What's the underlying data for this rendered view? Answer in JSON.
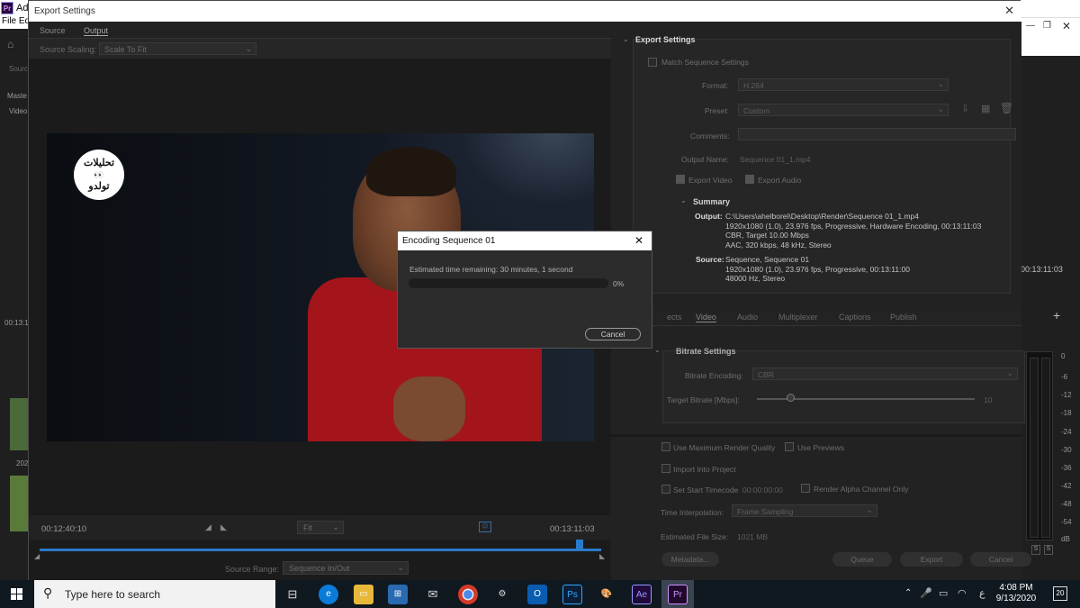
{
  "app": {
    "title": "Ado",
    "menu": [
      "File",
      "Ed"
    ],
    "left_panel_labels": [
      "Sourc",
      "Maste",
      "Video",
      "00:13:1",
      "202"
    ],
    "right_timecode": "00:13:11:03",
    "meter_db": [
      "0",
      "-6",
      "-12",
      "-18",
      "-24",
      "-30",
      "-36",
      "-42",
      "-48",
      "-54",
      "dB"
    ],
    "meter_solo": [
      "S",
      "S"
    ]
  },
  "dialog": {
    "title": "Export Settings",
    "tabs": [
      "Source",
      "Output"
    ],
    "source_scaling_label": "Source Scaling:",
    "source_scaling_value": "Scale To Fit",
    "preview_logo_text": [
      "تحليلات",
      "👀",
      "تولدو"
    ],
    "time_in": "00:12:40:10",
    "time_out": "00:13:11:03",
    "fit_label": "Fit",
    "source_range_label": "Source Range:",
    "source_range_value": "Sequence In/Out"
  },
  "export_settings": {
    "header": "Export Settings",
    "match_sequence": "Match Sequence Settings",
    "format_label": "Format:",
    "format_value": "H.264",
    "preset_label": "Preset:",
    "preset_value": "Custom",
    "comments_label": "Comments:",
    "output_name_label": "Output Name:",
    "output_name_value": "Sequence 01_1.mp4",
    "export_video": "Export Video",
    "export_audio": "Export Audio",
    "summary_header": "Summary",
    "output_key": "Output:",
    "output_lines": [
      "C:\\Users\\ahelborei\\Desktop\\Render\\Sequence 01_1.mp4",
      "1920x1080 (1.0), 23.976 fps, Progressive, Hardware Encoding, 00:13:11:03",
      "CBR, Target 10.00 Mbps",
      "AAC, 320 kbps, 48 kHz, Stereo"
    ],
    "source_key": "Source:",
    "source_lines": [
      "Sequence, Sequence 01",
      "1920x1080 (1.0), 23.976 fps, Progressive, 00:13:11:00",
      "48000 Hz, Stereo"
    ],
    "sub_tabs": [
      "ects",
      "Video",
      "Audio",
      "Multiplexer",
      "Captions",
      "Publish"
    ],
    "bitrate_header": "Bitrate Settings",
    "bitrate_encoding_label": "Bitrate Encoding:",
    "bitrate_encoding_value": "CBR",
    "target_bitrate_label": "Target Bitrate [Mbps]:",
    "target_bitrate_value": "10",
    "use_max_render": "Use Maximum Render Quality",
    "use_previews": "Use Previews",
    "import_into_project": "Import Into Project",
    "set_start_timecode": "Set Start Timecode",
    "start_timecode_value": "00:00:00:00",
    "render_alpha": "Render Alpha Channel Only",
    "time_interp_label": "Time Interpolation:",
    "time_interp_value": "Frame Sampling",
    "est_size_label": "Estimated File Size:",
    "est_size_value": "1021 MB",
    "metadata_btn": "Metadata...",
    "queue_btn": "Queue",
    "export_btn": "Export",
    "cancel_btn": "Cancel"
  },
  "encoding": {
    "title": "Encoding Sequence 01",
    "message": "Estimated time remaining: 30 minutes, 1 second",
    "percent": "0%",
    "progress": 0,
    "cancel": "Cancel"
  },
  "taskbar": {
    "search_placeholder": "Type here to search",
    "apps": [
      "task-view",
      "edge",
      "explorer",
      "store",
      "mail",
      "chrome",
      "network",
      "outlook",
      "Ps",
      "paint",
      "Ae",
      "Pr"
    ],
    "lang": "ع",
    "time": "4:08 PM",
    "date": "9/13/2020",
    "notifications": "20"
  }
}
